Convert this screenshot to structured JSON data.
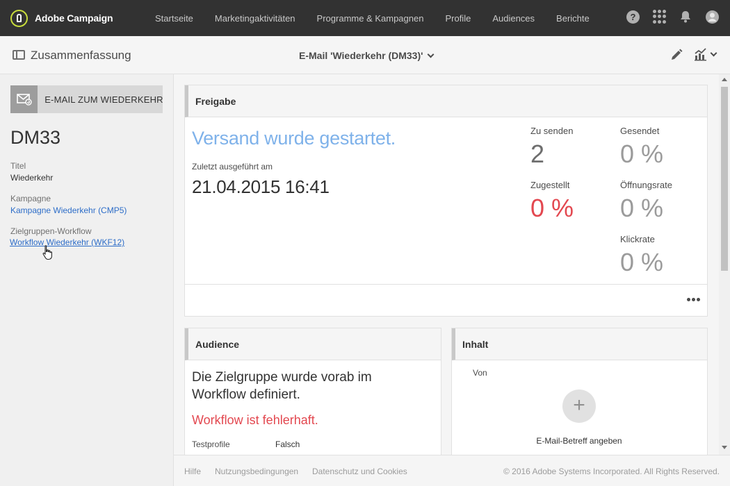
{
  "app": {
    "name": "Adobe Campaign"
  },
  "nav": {
    "items": [
      "Startseite",
      "Marketingaktivitäten",
      "Programme & Kampagnen",
      "Profile",
      "Audiences",
      "Berichte"
    ],
    "icons": [
      "help-icon",
      "apps-grid-icon",
      "bell-icon",
      "user-avatar-icon"
    ]
  },
  "subheader": {
    "summary_label": "Zusammenfassung",
    "title": "E-Mail 'Wiederkehr (DM33)'"
  },
  "left": {
    "type_label": "E-MAIL ZUM WIEDERKEHR...",
    "code": "DM33",
    "title_label": "Titel",
    "title_value": "Wiederkehr",
    "campaign_label": "Kampagne",
    "campaign_value": "Kampagne Wiederkehr (CMP5)",
    "workflow_label": "Zielgruppen-Workflow",
    "workflow_value": "Workflow Wiederkehr (WKF12)"
  },
  "freigabe": {
    "heading": "Freigabe",
    "status": "Versand wurde gestartet.",
    "last_run_label": "Zuletzt ausgeführt am",
    "last_run_value": "21.04.2015 16:41",
    "kpis": {
      "to_send_label": "Zu senden",
      "to_send_value": "2",
      "sent_label": "Gesendet",
      "sent_value": "0 %",
      "delivered_label": "Zugestellt",
      "delivered_value": "0 %",
      "open_label": "Öffnungsrate",
      "open_value": "0 %",
      "click_label": "Klickrate",
      "click_value": "0 %"
    }
  },
  "audience": {
    "heading": "Audience",
    "text": "Die Zielgruppe wurde vorab im Workflow definiert.",
    "error": "Workflow ist fehlerhaft.",
    "test_profiles_label": "Testprofile",
    "test_profiles_value": "Falsch"
  },
  "content": {
    "heading": "Inhalt",
    "from_label": "Von",
    "subject_prompt": "E-Mail-Betreff angeben"
  },
  "footer": {
    "help": "Hilfe",
    "terms": "Nutzungsbedingungen",
    "privacy": "Datenschutz und Cookies",
    "copyright": "© 2016 Adobe Systems Incorporated. All Rights Reserved."
  },
  "colors": {
    "nav_bg": "#323232",
    "accent_blue": "#7fb2ea",
    "link_blue": "#2d6dc8",
    "error_red": "#e34850",
    "brand_lime": "#c8dc3c"
  }
}
